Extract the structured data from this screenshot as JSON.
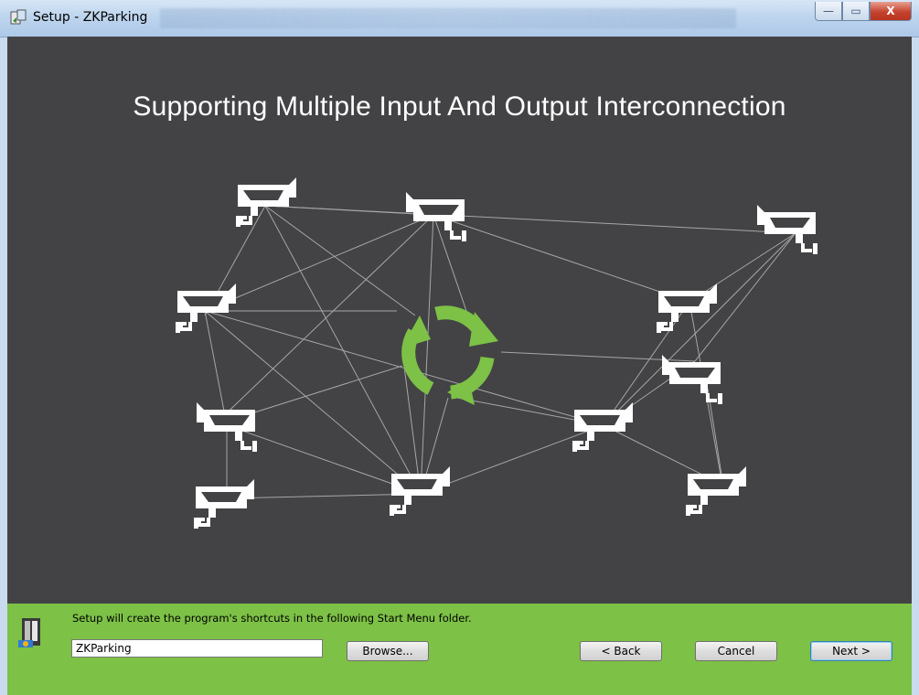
{
  "window": {
    "title": "Setup - ZKParking",
    "controls": {
      "minimize": "—",
      "maximize": "▭",
      "close": "X"
    }
  },
  "banner": {
    "headline": "Supporting Multiple Input And Output Interconnection",
    "accent_color": "#7dc146",
    "background_color": "#434345",
    "icons": {
      "camera": "cctv-camera-icon",
      "center": "sync-arrows-icon"
    }
  },
  "footer": {
    "message": "Setup will create the program's shortcuts in the following Start Menu folder.",
    "folder_value": "ZKParking",
    "browse_label": "Browse...",
    "back_label": "< Back",
    "cancel_label": "Cancel",
    "next_label": "Next >"
  }
}
